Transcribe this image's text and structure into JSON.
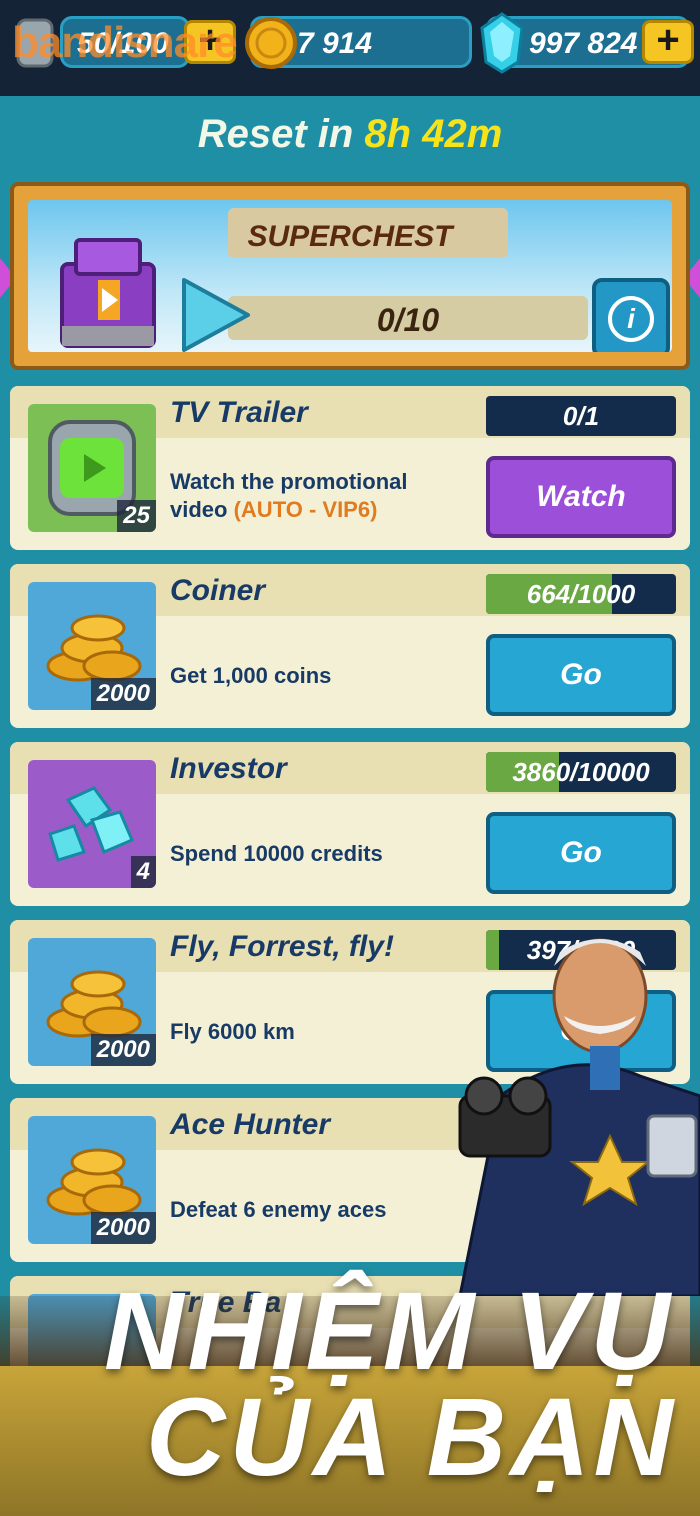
{
  "top_bar": {
    "watermark": "bandisnare",
    "energy": "50/100",
    "coins": "7 914",
    "gems": "997 824"
  },
  "reset": {
    "label": "Reset in ",
    "time": "8h 42m"
  },
  "superchest": {
    "title": "SUPERCHEST",
    "progress_text": "0/10",
    "info_label": "i"
  },
  "missions": [
    {
      "title": "TV Trailer",
      "desc": "Watch the promotional video",
      "desc_highlight": "(AUTO - VIP6)",
      "reward_count": "25",
      "progress_text": "0/1",
      "progress": 0,
      "button": "Watch",
      "icon": "tv-capsule-icon"
    },
    {
      "title": "Coiner",
      "desc": "Get 1,000 coins",
      "reward_count": "2000",
      "progress_text": "664/1000",
      "progress": 0.664,
      "button": "Go",
      "icon": "coins-icon"
    },
    {
      "title": "Investor",
      "desc": "Spend 10000 credits",
      "reward_count": "4",
      "progress_text": "3860/10000",
      "progress": 0.386,
      "button": "Go",
      "icon": "gems-icon"
    },
    {
      "title": "Fly, Forrest, fly!",
      "desc": "Fly 6000 km",
      "reward_count": "2000",
      "progress_text": "397/6000",
      "progress": 0.066,
      "button": "Go",
      "icon": "coins-icon"
    },
    {
      "title": "Ace Hunter",
      "desc": "Defeat 6 enemy aces",
      "reward_count": "2000",
      "icon": "coins-icon"
    },
    {
      "title": "True Ba",
      "icon": "mystery-icon"
    }
  ],
  "banner": {
    "line1": "NHIỆM VỤ",
    "line2": "CỦA BẠN"
  },
  "colors": {
    "background": "#1f8fa6",
    "progress_fill": "#6aa843",
    "go_button": "#25a6d3",
    "watch_button": "#9c4fd8",
    "highlight": "#e07b1f"
  }
}
